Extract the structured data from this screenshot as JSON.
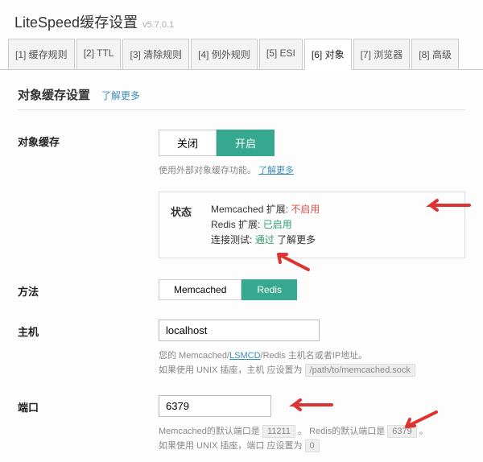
{
  "header": {
    "title": "LiteSpeed缓存设置",
    "version": "v5.7.0.1"
  },
  "tabs": [
    {
      "label": "[1] 缓存规则"
    },
    {
      "label": "[2] TTL"
    },
    {
      "label": "[3] 清除规则"
    },
    {
      "label": "[4] 例外规则"
    },
    {
      "label": "[5] ESI"
    },
    {
      "label": "[6] 对象"
    },
    {
      "label": "[7] 浏览器"
    },
    {
      "label": "[8] 高级"
    }
  ],
  "section": {
    "title": "对象缓存设置",
    "learn_more": "了解更多"
  },
  "obj_cache": {
    "label": "对象缓存",
    "off": "关闭",
    "on": "开启",
    "hint_pre": "使用外部对象缓存功能。",
    "hint_link": "了解更多"
  },
  "status": {
    "label": "状态",
    "memcached_pre": "Memcached 扩展:",
    "memcached_val": "不启用",
    "redis_pre": "Redis 扩展:",
    "redis_val": "已启用",
    "conn_pre": "连接测试:",
    "conn_val": "通过",
    "conn_link": "了解更多"
  },
  "method": {
    "label": "方法",
    "memcached": "Memcached",
    "redis": "Redis"
  },
  "host": {
    "label": "主机",
    "value": "localhost",
    "hint_a": "您的 Memcached/",
    "hint_link": "LSMCD",
    "hint_b": "/Redis 主机名或者IP地址。",
    "hint2_a": "如果使用 UNIX 插座，主机 应设置为",
    "hint2_code": "/path/to/memcached.sock"
  },
  "port": {
    "label": "端口",
    "value": "6379",
    "hint_a": "Memcached的默认端口是",
    "hint_code1": "11211",
    "hint_b": "。 Redis的默认端口是",
    "hint_code2": "6379",
    "hint_c": "。",
    "hint2_a": "如果使用 UNIX 插座，端口 应设置为",
    "hint2_code": "0"
  }
}
